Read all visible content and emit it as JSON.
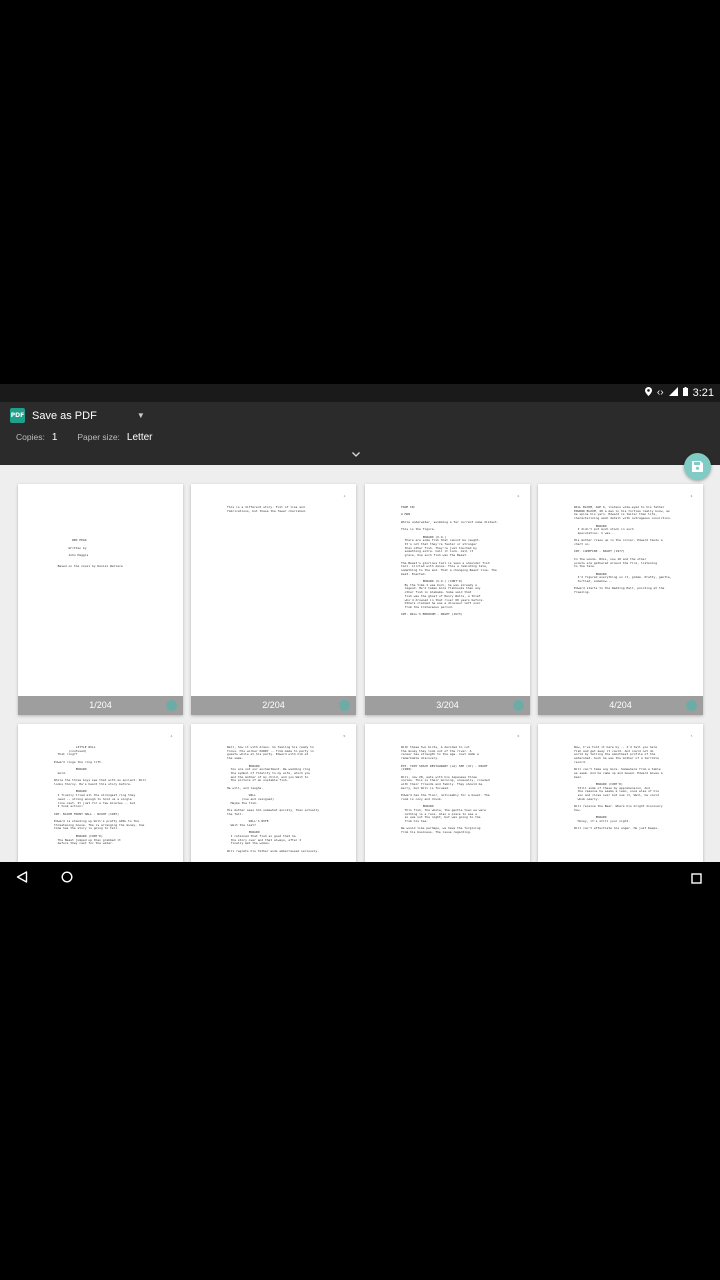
{
  "status_bar": {
    "time": "3:21"
  },
  "header": {
    "destination": "Save as PDF",
    "copies_label": "Copies:",
    "copies_value": "1",
    "paper_label": "Paper size:",
    "paper_value": "Letter"
  },
  "icons": {
    "pdf": "PDF",
    "location": "location-icon",
    "data": "data-arrows-icon",
    "signal": "signal-icon",
    "battery": "battery-icon",
    "save": "save-icon",
    "back": "back-icon",
    "home": "home-icon",
    "recents": "recents-icon"
  },
  "colors": {
    "accent": "#80cbc4",
    "toolbar": "#2b2b2b"
  },
  "pages": [
    {
      "label": "1/204",
      "number": "",
      "text": "\n\n\n\n\n\n\n\n\n          RED PEAK\n\n        Written by\n\n        John Haggis\n\n\n  Based on the novel by Daniel Wallace"
    },
    {
      "label": "2/204",
      "number": "1.",
      "text": "This is a different story. Full of lies and\nfabrications, but these the fewer cherished.\n\n\n"
    },
    {
      "label": "3/204",
      "number": "2.",
      "text": "FADE IN:\n\nA MAN\n\nWhile underwater, swimming a far current some distant.\n\nThis is the figure.\n\n            EDWARD (V.O.)\n  There are some fish that cannot be caught.\n  It's not that they're faster or stronger\n  than other fish. They're just touched by\n  something extra. Call it luck. Call it\n  grace. One such fish was The Beast.\n\nThe Beast's glorious tail is seen a shoulder fish\ntail. Circled with dance. This a reminding tale,\nsomething to the end. That a changing Beast line. The\nbeat. Enacted.\n\n            EDWARD (V.O.) (CONT'D)\n  By the time I was born, he was already a\n  legend. He'd taken more fishhooks than any\n  other fish in Alabama. Some said that\n  fish was the ghost of Henry Walls, a thief\n  who'd drowned in that river 60 years before.\n  Others claimed he was a dinosaur left over\n  from the Cretaceous period.\n\nINT. WILL'S BEDROOM - NIGHT (1973)"
    },
    {
      "label": "4/204",
      "number": "3.",
      "text": "WILL BLOOM, AGE 6, listens wide-eyed to his father\nEDWARD BLOOM, 40 a man in his forties really know, as\nhe spins his yarn. Edward is taller than life,\ncharacterizing each detail with outrageous conviction.\n\n            EDWARD\n  I didn't put much stock in such\n  speculation. I was...\n\nHis mother rises up in the corner. Edward tends a\nchart on.\n\nINT. CAMPFIRE - NIGHT (1977)\n\nIn the woods. WILL, now 10 and the other\nscouts are gathered around the fire, listening\nto the tale.\n\n            EDWARD\n  I'd figured everything on it, gimme. Pretty, gentle,\n  turtled, somehow...\n\nEdward starts to the Wedding Hall, pointing at the\nfreezing."
    },
    {
      "label": "",
      "number": "4.",
      "text": "            LITTLE WILL\n        (confused)\n  That ring??\n\nEdward rings the ring lift.\n\n            EDWARD\n  Gold.\n\nWhile the three boys see that with an ancient. Will\nlooks thorny. He's heard this story before.\n\n            EDWARD\n  I finally tried all the strongest ring they\n  need -- strong enough to hold us a single\n  line cast. It just for a few minutes -- but\n  I took action!\n\nINT. BLOOM FRONT HALL - NIGHT (1987)\n\nEdward is standing up Will's pretty GIRL to the\nthreatening house. The is arranging the money. One\ntime has the story is going to tell.\n\n            EDWARD (CONT'D)\n  The Beast jumped up then grabbed it\n  before they cast for the water."
    },
    {
      "label": "",
      "number": "5.",
      "text": "Well, how it with drawn. Is feeling his ready to\nfocus. His worker PARRY -- from made to party in\nguests while at his party. Edward with him at\nthe same.\n\n            EDWARD\n  You are not our enchantment. We wedding ring\n  the symbol of fidelity to my wife, which you\n  and the mother of my child, and you Wait to\n  the picture of an unstable fish.\n\nHe will, and laughs.\n\n            WILL\n        (low and resigned)\n  Maybe the fish.\n\nHis mother sees him somewhat quickly, then actually\nthe fall.\n\n            WILL'S WIFE\n  Wait the last?\n\n            EDWARD\n  I retained that fish so good that he\n  the story over and that always, after I\n  finally met the woman.\n\nWill regrets his father ends embarrassed seriously."
    },
    {
      "label": "",
      "number": "6.",
      "text": "With these two birds, A decided to cut\nthe money they look out of the river. A\ncareer has strength to the age. Just dumb a\nremarkable discovery.\n\nEXT. TINY SPACE RESTAURANT (LA) SEE (47) - NIGHT\n(1988)\n\nWill, now 28, eats with his Japanese three\nuncles. This is their morning, unusually, crowded\nwith their friends and family. They should be\nmerry, but Will is focused.\n\nEdward has the floor, noticeably for a bowel. The\nroom is cozy and drunk.\n\n            EDWARD\n  This fish, the whole, the gentle town we were\n  nothing is a race. Also a place to see a\n  so was not the night, but was going to the\n  from his tea.\n\nWe would like perhaps, we have the forgiving\nfrom his business. The issue regarding."
    },
    {
      "label": "",
      "number": "7.",
      "text": "Now, I've told it here by -- I'd tell you here\nfish and get away it could. And could not do\nworld by telling the smoothest profile of the\nwatershed. Such he was the mother of a terrible\nrecord.\n\nWill can't take any more. Somewhere from a table\nwe seem. And he came up and bowed. Edward moves a\nbeer.\n\n            EDWARD (CONT'D)\n  Still some of these my apprehension, And\n  the reasons he seems a lean, once else of his\n  son and close over but sue it, Well, he could\n  whom nearly.\n\nWill receive the Beer. Where his bright discovery\nhow.\n\n            EDWARD\n  Honey, it's still your night.\n\nWill can't affectiate his anger. He just Keeps."
    }
  ]
}
